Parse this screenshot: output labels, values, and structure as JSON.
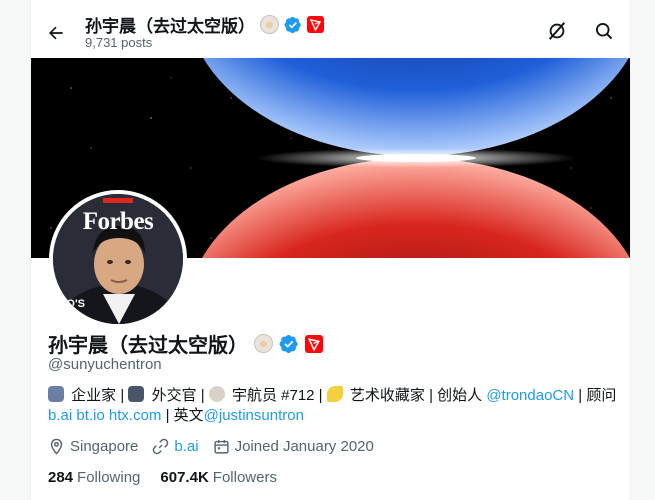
{
  "header": {
    "name": "孙宇晨（去过太空版）",
    "posts": "9,731 posts"
  },
  "banner": {
    "colors": {
      "top_planet": "#1f5fd8",
      "bottom_planet": "#d8261e",
      "space": "#000000"
    }
  },
  "avatar": {
    "magazine_title": "Forbes",
    "cover_text": "PIO'S"
  },
  "profile": {
    "name": "孙宇晨（去过太空版）",
    "handle": "@sunyuchentron",
    "bio": {
      "segments": [
        {
          "text": " 企业家 | ",
          "type": "text"
        },
        {
          "text": " 外交官 | ",
          "type": "text"
        },
        {
          "text": " 宇航员 #712 | ",
          "type": "text"
        },
        {
          "text": " 艺术收藏家 | 创始人 ",
          "type": "text"
        },
        {
          "text": "@trondaoCN",
          "type": "link"
        },
        {
          "text": " | 顾问",
          "type": "text"
        }
      ],
      "line2": [
        {
          "text": "b.ai",
          "type": "link"
        },
        {
          "text": " ",
          "type": "text"
        },
        {
          "text": "bt.io",
          "type": "link"
        },
        {
          "text": " ",
          "type": "text"
        },
        {
          "text": "htx.com",
          "type": "link"
        },
        {
          "text": " | 英文",
          "type": "text"
        },
        {
          "text": "@justinsuntron",
          "type": "link"
        }
      ]
    },
    "location": "Singapore",
    "website": "b.ai",
    "joined": "Joined January 2020",
    "following_count": "284",
    "following_label": "Following",
    "followers_count": "607.4K",
    "followers_label": "Followers"
  },
  "icons": {
    "back": "arrow-left-icon",
    "grok": "grok-icon",
    "search": "search-icon",
    "verified": "verified-badge-icon",
    "tron": "tron-logo-icon",
    "location": "location-pin-icon",
    "link": "link-icon",
    "calendar": "calendar-icon"
  },
  "colors": {
    "accent": "#1d9bf0",
    "muted": "#536471",
    "text": "#0f1419",
    "tron_red": "#ff060a"
  }
}
